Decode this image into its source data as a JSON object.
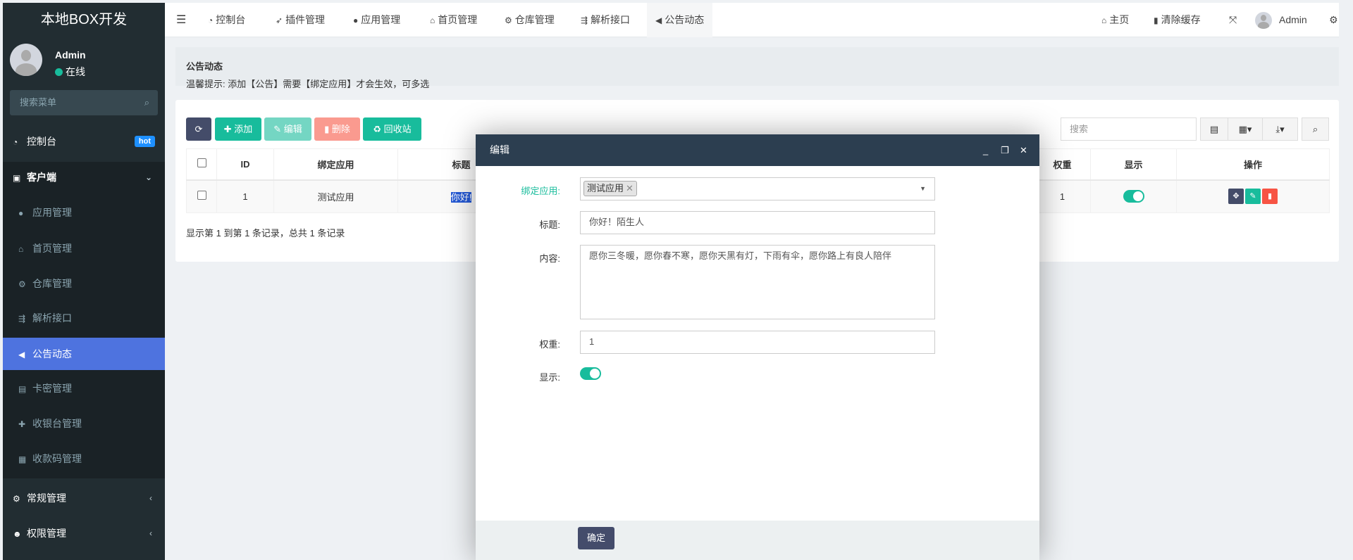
{
  "app": {
    "brand": "本地BOX开发"
  },
  "user": {
    "name": "Admin",
    "status": "在线"
  },
  "sidebar": {
    "search_placeholder": "搜索菜单",
    "items": [
      {
        "label": "控制台",
        "icon": "dashboard-icon",
        "badge": "hot"
      },
      {
        "label": "客户端",
        "icon": "inbox-icon"
      },
      {
        "label": "应用管理",
        "icon": "android-icon"
      },
      {
        "label": "首页管理",
        "icon": "home-icon"
      },
      {
        "label": "仓库管理",
        "icon": "cogs-icon"
      },
      {
        "label": "解析接口",
        "icon": "usb-icon"
      },
      {
        "label": "公告动态",
        "icon": "bullhorn-icon",
        "active": true
      },
      {
        "label": "卡密管理",
        "icon": "id-card-icon"
      },
      {
        "label": "收银台管理",
        "icon": "user-plus-icon"
      },
      {
        "label": "收款码管理",
        "icon": "qrcode-icon"
      },
      {
        "label": "常规管理",
        "icon": "cogs-icon"
      },
      {
        "label": "权限管理",
        "icon": "users-icon"
      }
    ]
  },
  "topnav": {
    "tabs": [
      "控制台",
      "插件管理",
      "应用管理",
      "首页管理",
      "仓库管理",
      "解析接口",
      "公告动态"
    ],
    "home": "主页",
    "clear_cache": "清除缓存",
    "user": "Admin"
  },
  "page": {
    "title": "公告动态",
    "tip": "温馨提示: 添加【公告】需要【绑定应用】才会生效，可多选"
  },
  "toolbar": {
    "add": "添加",
    "edit": "编辑",
    "delete": "删除",
    "recycle": "回收站",
    "search_placeholder": "搜索"
  },
  "table": {
    "headers": [
      "ID",
      "绑定应用",
      "标题",
      "权重",
      "显示",
      "操作"
    ],
    "rows": [
      {
        "id": "1",
        "app": "测试应用",
        "title": "你好!",
        "weight": "1",
        "show": true
      }
    ]
  },
  "pagination": "显示第 1 到第 1 条记录，总共 1 条记录",
  "modal": {
    "title": "编辑",
    "labels": {
      "app": "绑定应用:",
      "title": "标题:",
      "content": "内容:",
      "weight": "权重:",
      "show": "显示:"
    },
    "values": {
      "app_tag": "测试应用",
      "title": "你好！陌生人",
      "content": "愿你三冬暖，愿你春不寒，愿你天黑有灯，下雨有伞，愿你路上有良人陪伴",
      "weight": "1",
      "show": true
    },
    "confirm": "确定"
  },
  "colors": {
    "sidebar": "#222d32",
    "active": "#4e73df",
    "primary": "#18bc9c",
    "modal_header": "#2c3e50",
    "danger": "#f75444"
  }
}
